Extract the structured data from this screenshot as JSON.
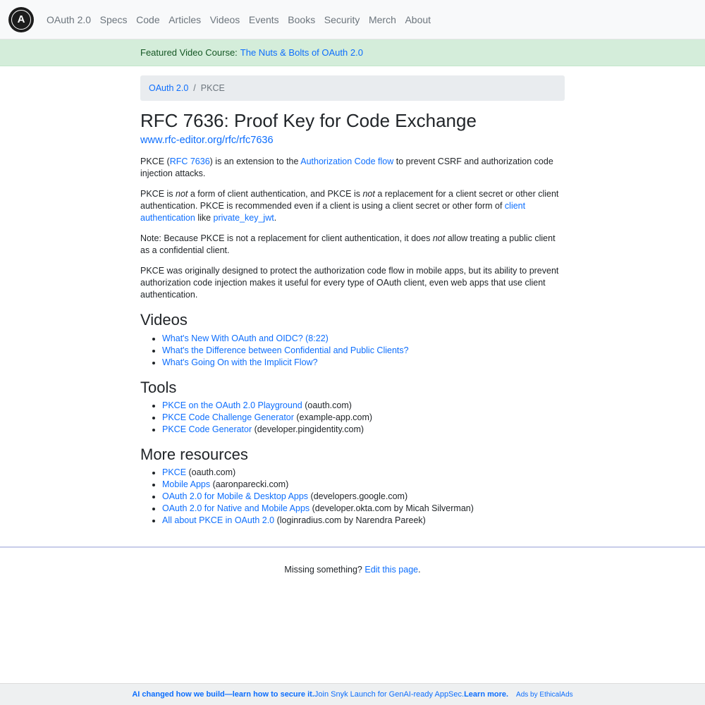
{
  "nav": {
    "logo": "A",
    "items": [
      "OAuth 2.0",
      "Specs",
      "Code",
      "Articles",
      "Videos",
      "Events",
      "Books",
      "Security",
      "Merch",
      "About"
    ]
  },
  "banner": {
    "label": "Featured Video Course:",
    "link": "The Nuts & Bolts of OAuth 2.0"
  },
  "breadcrumb": {
    "home": "OAuth 2.0",
    "separator": "/",
    "current": "PKCE"
  },
  "page": {
    "title": "RFC 7636: Proof Key for Code Exchange",
    "rfc_link": "www.rfc-editor.org/rfc/rfc7636",
    "p1": {
      "a": "PKCE (",
      "link1": "RFC 7636",
      "b": ") is an extension to the ",
      "link2": "Authorization Code flow",
      "c": " to prevent CSRF and authorization code injection attacks."
    },
    "p2": {
      "a": "PKCE is ",
      "em1": "not",
      "b": " a form of client authentication, and PKCE is ",
      "em2": "not",
      "c": " a replacement for a client secret or other client authentication. PKCE is recommended even if a client is using a client secret or other form of ",
      "link1": "client authentication",
      "d": " like ",
      "link2": "private_key_jwt",
      "e": "."
    },
    "p3": {
      "a": "Note: Because PKCE is not a replacement for client authentication, it does ",
      "em": "not",
      "b": " allow treating a public client as a confidential client."
    },
    "p4": "PKCE was originally designed to protect the authorization code flow in mobile apps, but its ability to prevent authorization code injection makes it useful for every type of OAuth client, even web apps that use client authentication."
  },
  "videos": {
    "heading": "Videos",
    "items": [
      "What's New With OAuth and OIDC? (8:22)",
      "What's the Difference between Confidential and Public Clients?",
      "What's Going On with the Implicit Flow?"
    ]
  },
  "tools": {
    "heading": "Tools",
    "items": [
      {
        "link": "PKCE on the OAuth 2.0 Playground",
        "source": " (oauth.com)"
      },
      {
        "link": "PKCE Code Challenge Generator",
        "source": " (example-app.com)"
      },
      {
        "link": "PKCE Code Generator",
        "source": " (developer.pingidentity.com)"
      }
    ]
  },
  "resources": {
    "heading": "More resources",
    "items": [
      {
        "link": "PKCE",
        "source": " (oauth.com)"
      },
      {
        "link": "Mobile Apps",
        "source": " (aaronparecki.com)"
      },
      {
        "link": "OAuth 2.0 for Mobile & Desktop Apps",
        "source": " (developers.google.com)"
      },
      {
        "link": "OAuth 2.0 for Native and Mobile Apps",
        "source": " (developer.okta.com by Micah Silverman)"
      },
      {
        "link": "All about PKCE in OAuth 2.0",
        "source": " (loginradius.com by Narendra Pareek)"
      }
    ]
  },
  "footer": {
    "text": "Missing something? ",
    "link": "Edit this page",
    "end": "."
  },
  "ad": {
    "bold1": "AI changed how we build—learn how to secure it.",
    "text": " Join Snyk Launch for GenAI-ready AppSec. ",
    "bold2": "Learn more.",
    "ethical": "Ads by EthicalAds"
  }
}
